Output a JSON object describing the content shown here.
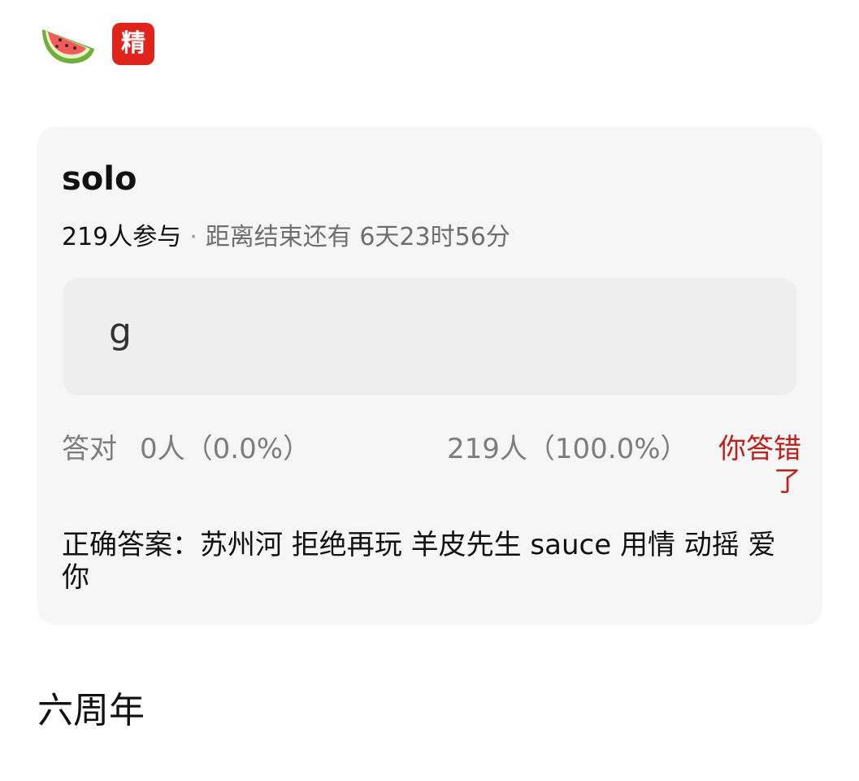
{
  "header": {
    "emoji_icon": "watermelon-icon",
    "badge_label": "精",
    "badge_color": "#e0241b"
  },
  "quiz_card": {
    "title": "solo",
    "participants": "219人参与",
    "separator": "·",
    "countdown": "距离结束还有 6天23时56分",
    "submitted_answer": "g",
    "correct_label": "答对",
    "correct_count": "0人（0.0%）",
    "wrong_count": "219人（100.0%）",
    "wrong_note": "你答错了",
    "correct_answer": "正确答案：苏州河 拒绝再玩 羊皮先生 sauce 用情 动摇 爱你"
  },
  "section": {
    "title": "六周年"
  },
  "colors": {
    "accent_red": "#c0201a",
    "card_bg": "#f6f6f6",
    "answer_box_bg": "#eeeeee"
  }
}
